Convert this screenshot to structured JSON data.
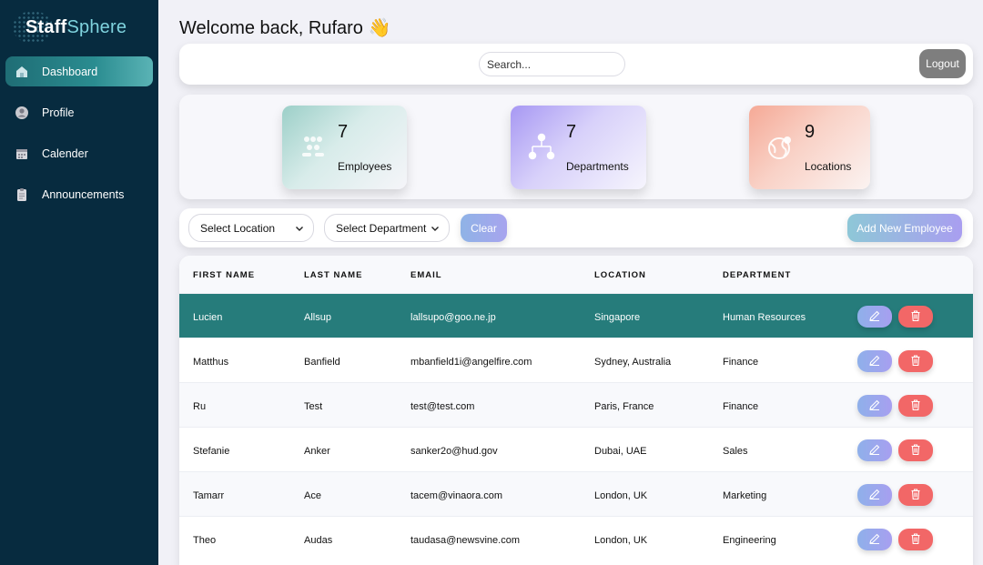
{
  "brand": {
    "part1": "Staff",
    "part2": "Sphere"
  },
  "sidebar": {
    "items": [
      {
        "label": "Dashboard",
        "icon": "home-icon",
        "active": true
      },
      {
        "label": "Profile",
        "icon": "user-icon",
        "active": false
      },
      {
        "label": "Calender",
        "icon": "calendar-icon",
        "active": false
      },
      {
        "label": "Announcements",
        "icon": "clipboard-icon",
        "active": false
      }
    ]
  },
  "header": {
    "welcome": "Welcome back, Rufaro 👋",
    "search_placeholder": "Search...",
    "logout_label": "Logout"
  },
  "stats": {
    "employees": {
      "value": "7",
      "label": "Employees",
      "icon": "people-icon"
    },
    "departments": {
      "value": "7",
      "label": "Departments",
      "icon": "org-chart-icon"
    },
    "locations": {
      "value": "9",
      "label": "Locations",
      "icon": "globe-icon"
    }
  },
  "filters": {
    "location_label": "Select Location",
    "department_label": "Select Department",
    "clear_label": "Clear",
    "add_label": "Add New Employee"
  },
  "table": {
    "columns": [
      "FIRST NAME",
      "LAST NAME",
      "EMAIL",
      "LOCATION",
      "DEPARTMENT"
    ],
    "rows": [
      {
        "first": "Lucien",
        "last": "Allsup",
        "email": "lallsupo@goo.ne.jp",
        "location": "Singapore",
        "department": "Human Resources"
      },
      {
        "first": "Matthus",
        "last": "Banfield",
        "email": "mbanfield1i@angelfire.com",
        "location": "Sydney, Australia",
        "department": "Finance"
      },
      {
        "first": "Ru",
        "last": "Test",
        "email": "test@test.com",
        "location": "Paris, France",
        "department": "Finance"
      },
      {
        "first": "Stefanie",
        "last": "Anker",
        "email": "sanker2o@hud.gov",
        "location": "Dubai, UAE",
        "department": "Sales"
      },
      {
        "first": "Tamarr",
        "last": "Ace",
        "email": "tacem@vinaora.com",
        "location": "London, UK",
        "department": "Marketing"
      },
      {
        "first": "Theo",
        "last": "Audas",
        "email": "taudasa@newsvine.com",
        "location": "London, UK",
        "department": "Engineering"
      }
    ]
  },
  "colors": {
    "sidebar_bg": "#072b3f",
    "active_nav": "#2a8c90",
    "selected_row": "#267c7b",
    "delete": "#f26767",
    "logout": "#7e7e7e"
  }
}
